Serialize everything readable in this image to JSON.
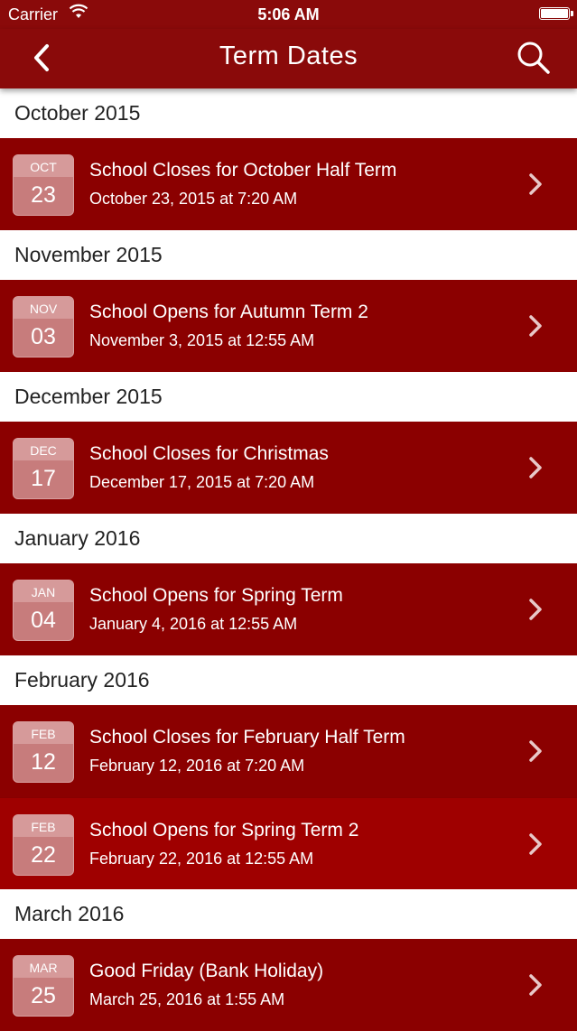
{
  "status_bar": {
    "carrier": "Carrier",
    "time": "5:06 AM"
  },
  "nav": {
    "title": "Term Dates",
    "back_icon": "chevron-left-icon",
    "search_icon": "search-icon"
  },
  "colors": {
    "brand_red": "#8a0a0a",
    "row_red": "#8b0000",
    "row_highlight": "#9f0000",
    "calendar_tile": "#c77c7c"
  },
  "sections": [
    {
      "header": "October 2015",
      "events": [
        {
          "month": "OCT",
          "day": "23",
          "title": "School Closes for October Half Term",
          "date": "October 23, 2015 at 7:20 AM"
        }
      ]
    },
    {
      "header": "November 2015",
      "events": [
        {
          "month": "NOV",
          "day": "03",
          "title": "School Opens for Autumn Term 2",
          "date": "November 3, 2015 at 12:55 AM"
        }
      ]
    },
    {
      "header": "December 2015",
      "events": [
        {
          "month": "DEC",
          "day": "17",
          "title": "School Closes for Christmas",
          "date": "December 17, 2015 at 7:20 AM"
        }
      ]
    },
    {
      "header": "January 2016",
      "events": [
        {
          "month": "JAN",
          "day": "04",
          "title": "School Opens for Spring Term",
          "date": "January 4, 2016 at 12:55 AM"
        }
      ]
    },
    {
      "header": "February 2016",
      "events": [
        {
          "month": "FEB",
          "day": "12",
          "title": "School Closes for February Half Term",
          "date": "February 12, 2016 at 7:20 AM"
        },
        {
          "month": "FEB",
          "day": "22",
          "title": "School Opens for Spring Term 2",
          "date": "February 22, 2016 at 12:55 AM",
          "highlighted": true
        }
      ]
    },
    {
      "header": "March 2016",
      "events": [
        {
          "month": "MAR",
          "day": "25",
          "title": "Good Friday (Bank Holiday)",
          "date": "March 25, 2016 at 1:55 AM"
        }
      ]
    }
  ]
}
